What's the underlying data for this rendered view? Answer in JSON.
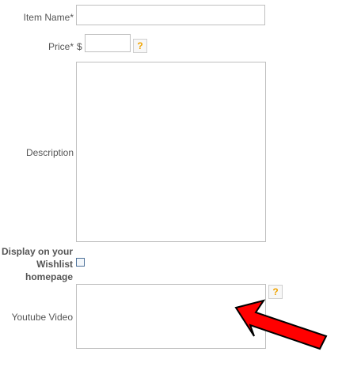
{
  "form": {
    "item_name": {
      "label": "Item Name*",
      "value": ""
    },
    "price": {
      "label": "Price*",
      "currency": "$",
      "value": "",
      "help_glyph": "?"
    },
    "description": {
      "label": "Description",
      "value": ""
    },
    "wishlist": {
      "label_line1": "Display on your",
      "label_line2": "Wishlist",
      "label_line3": "homepage",
      "checked": false
    },
    "youtube": {
      "label": "Youtube Video",
      "value": "",
      "help_glyph": "?"
    }
  },
  "colors": {
    "help_glyph": "#f0a400",
    "arrow_fill": "#ff0000",
    "field_border": "#bfbfbf",
    "label_text": "#555555"
  },
  "icons": {
    "help": "question-mark-icon",
    "annotation": "red-arrow-icon"
  }
}
